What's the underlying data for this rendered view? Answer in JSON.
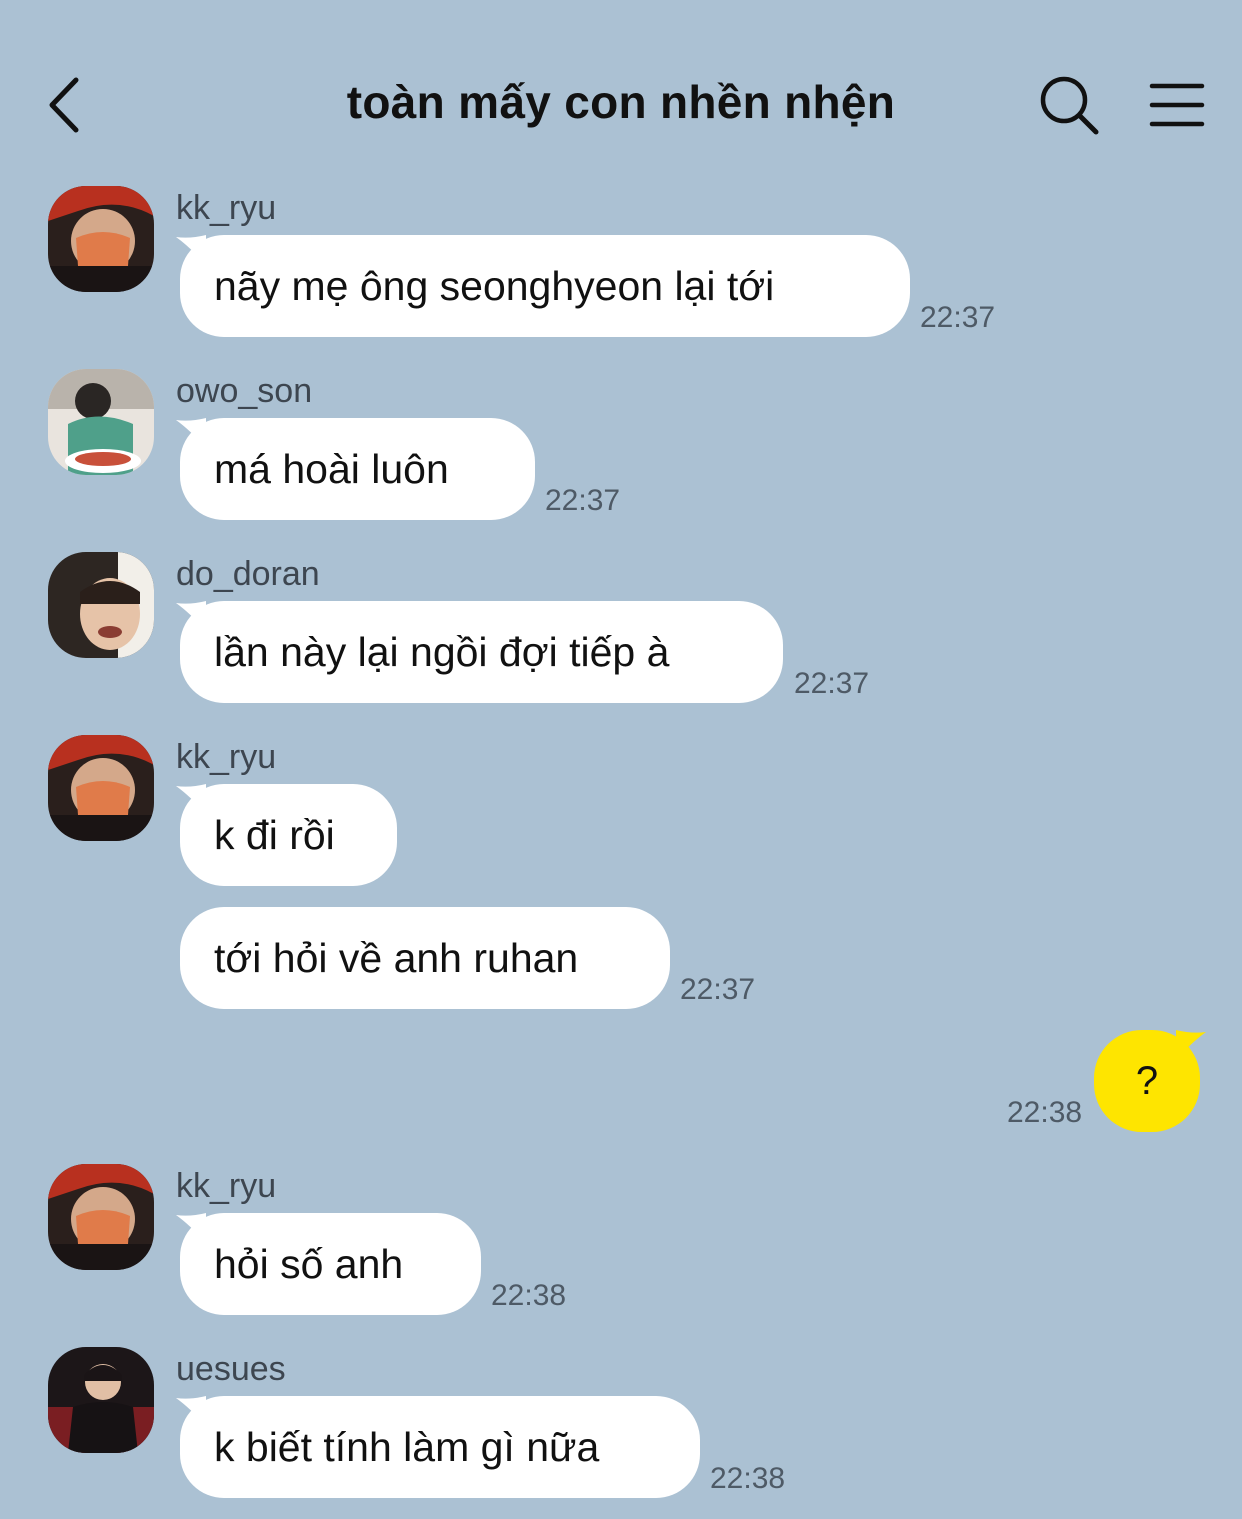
{
  "header": {
    "title": "toàn mấy con nhền nhện"
  },
  "messages": [
    {
      "sender": "kk_ryu",
      "text": "nãy mẹ ông seonghyeon lại tới",
      "time": "22:37"
    },
    {
      "sender": "owo_son",
      "text": "má hoài luôn",
      "time": "22:37"
    },
    {
      "sender": "do_doran",
      "text": "lần này lại ngồi đợi tiếp à",
      "time": "22:37"
    },
    {
      "sender": "kk_ryu",
      "text": "k đi rồi"
    },
    {
      "text": "tới hỏi về anh ruhan",
      "time": "22:37"
    },
    {
      "sender": "me",
      "text": "?",
      "time": "22:38"
    },
    {
      "sender": "kk_ryu",
      "text": "hỏi số anh",
      "time": "22:38"
    },
    {
      "sender": "uesues",
      "text": "k biết tính làm gì nữa",
      "time": "22:38"
    }
  ],
  "colors": {
    "background": "#abc1d3",
    "my_bubble": "#fee500",
    "their_bubble": "#ffffff"
  },
  "icons": {
    "back": "chevron-left-icon",
    "search": "search-icon",
    "menu": "hamburger-menu-icon"
  }
}
